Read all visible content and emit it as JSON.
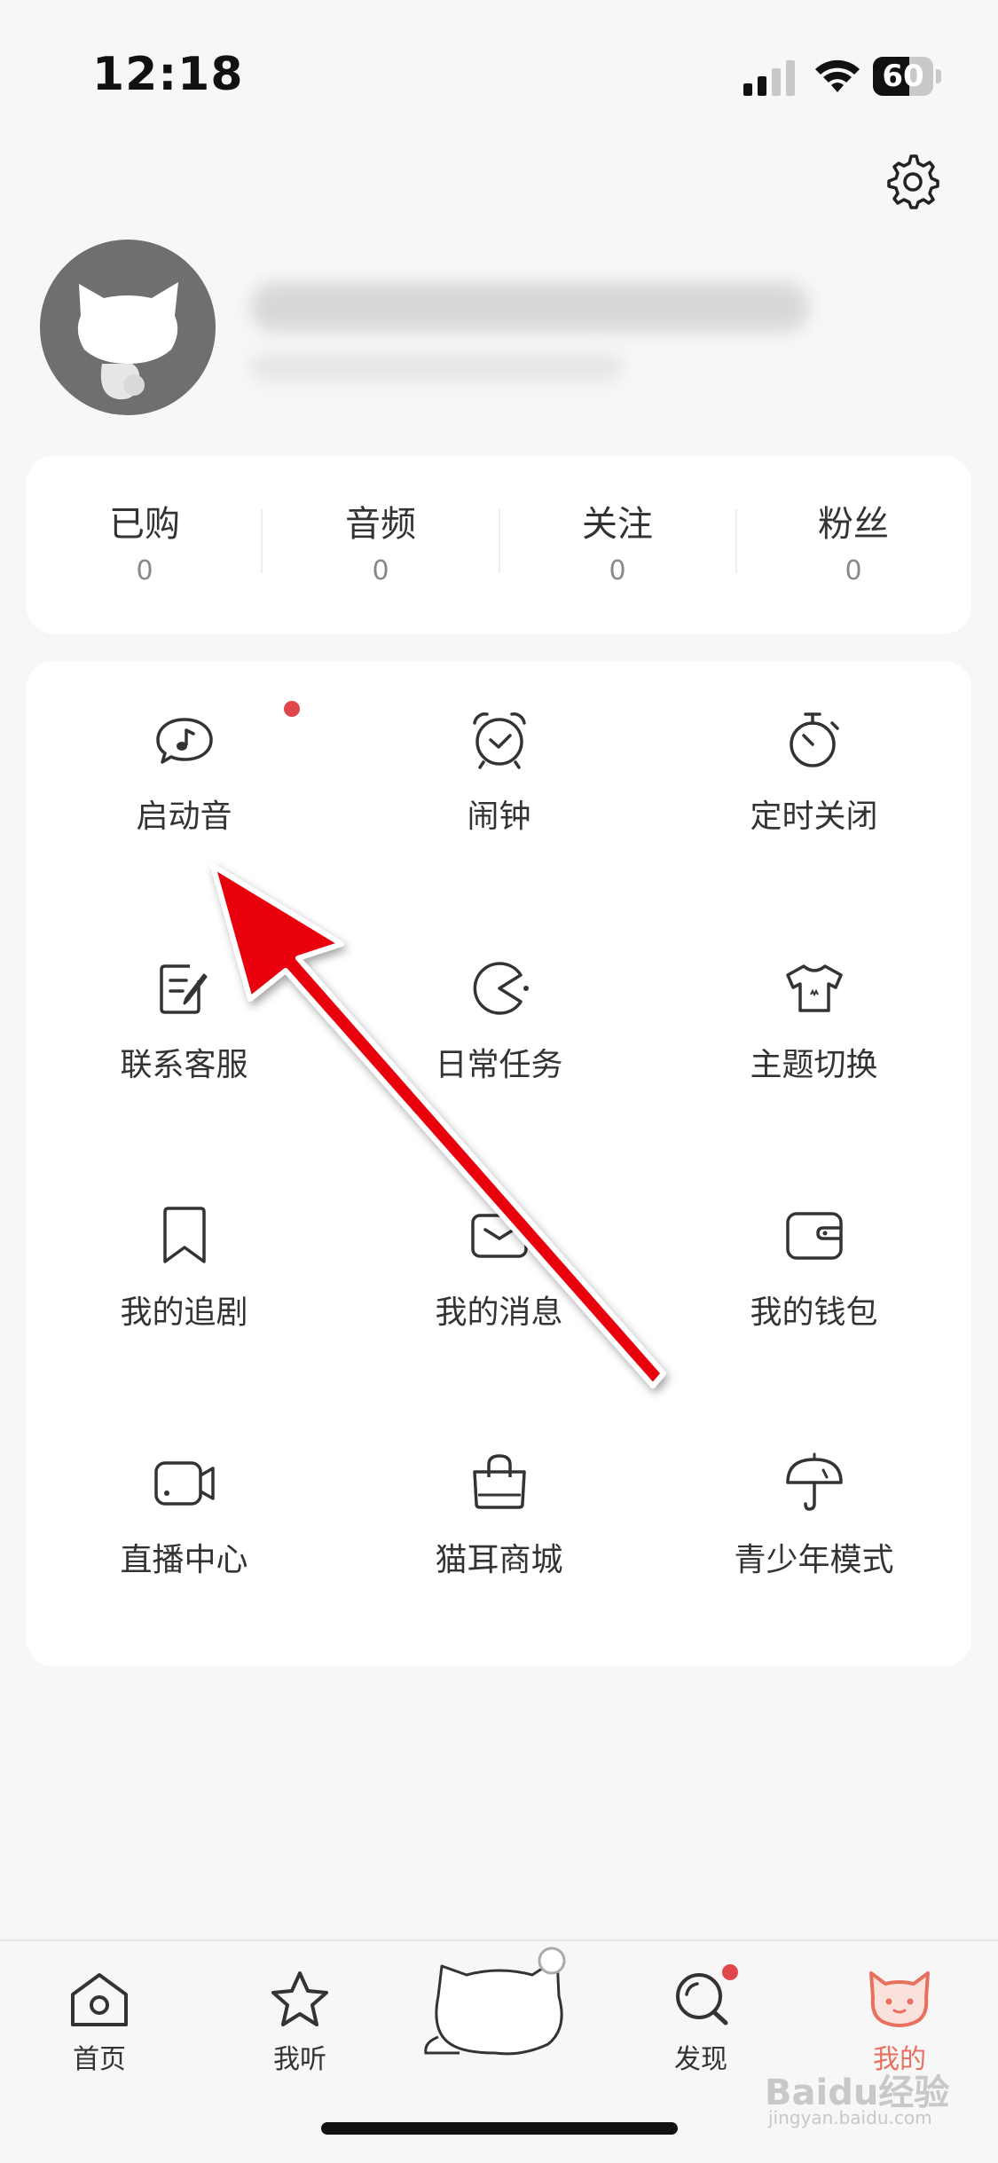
{
  "status_bar": {
    "time": "12:18",
    "battery_level": "60"
  },
  "profile": {
    "avatar_icon": "cat-avatar-icon",
    "settings_icon": "gear-icon"
  },
  "stats": [
    {
      "label": "已购",
      "value": "0"
    },
    {
      "label": "音频",
      "value": "0"
    },
    {
      "label": "关注",
      "value": "0"
    },
    {
      "label": "粉丝",
      "value": "0"
    }
  ],
  "menu": [
    {
      "label": "启动音",
      "icon": "music-bubble-icon",
      "badge": true
    },
    {
      "label": "闹钟",
      "icon": "alarm-clock-icon"
    },
    {
      "label": "定时关闭",
      "icon": "stopwatch-icon"
    },
    {
      "label": "联系客服",
      "icon": "edit-note-icon"
    },
    {
      "label": "日常任务",
      "icon": "pacman-icon"
    },
    {
      "label": "主题切换",
      "icon": "tshirt-icon"
    },
    {
      "label": "我的追剧",
      "icon": "bookmark-icon"
    },
    {
      "label": "我的消息",
      "icon": "envelope-icon"
    },
    {
      "label": "我的钱包",
      "icon": "wallet-icon"
    },
    {
      "label": "直播中心",
      "icon": "video-camera-icon"
    },
    {
      "label": "猫耳商城",
      "icon": "shopping-bag-icon"
    },
    {
      "label": "青少年模式",
      "icon": "umbrella-icon"
    }
  ],
  "tabbar": [
    {
      "label": "首页",
      "icon": "home-icon"
    },
    {
      "label": "我听",
      "icon": "star-icon"
    },
    {
      "label": "发现",
      "icon": "search-discover-icon",
      "badge": true
    },
    {
      "label": "我的",
      "icon": "cat-face-icon",
      "active": true
    }
  ],
  "watermark": {
    "text": "Baidu经验",
    "sub": "jingyan.baidu.com"
  },
  "colors": {
    "accent": "#e8705f",
    "badge": "#e0474c",
    "annotation_arrow": "#e8000b"
  }
}
